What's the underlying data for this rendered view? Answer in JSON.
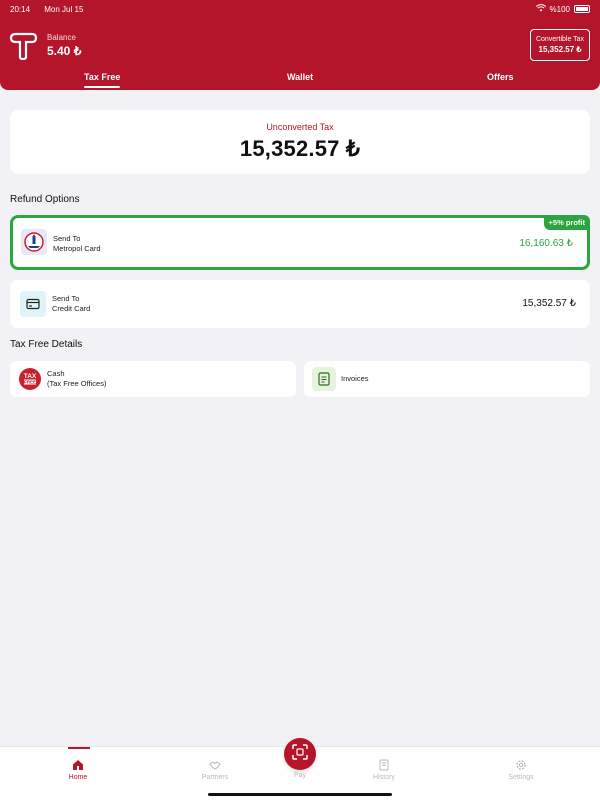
{
  "status_bar": {
    "time": "20:14",
    "date": "Mon Jul 15",
    "battery": "%100"
  },
  "header": {
    "balance_label": "Balance",
    "balance_value": "5.40 ₺",
    "convertible_label": "Convertible Tax",
    "convertible_value": "15,352.57 ₺",
    "tabs": [
      "Tax Free",
      "Wallet",
      "Offers"
    ],
    "active_tab": "Tax Free",
    "brand_color": "#b5152b"
  },
  "unconverted": {
    "label": "Unconverted Tax",
    "value": "15,352.57 ₺"
  },
  "refund": {
    "title": "Refund Options",
    "options": [
      {
        "line1": "Send To",
        "line2": "Metropol Card",
        "amount": "16,160.63 ₺",
        "badge": "+5% profit",
        "icon": "metropol-logo-icon",
        "accent": "#2aa53f"
      },
      {
        "line1": "Send To",
        "line2": "Credit Card",
        "amount": "15,352.57 ₺",
        "icon": "credit-card-icon"
      }
    ]
  },
  "details": {
    "title": "Tax Free Details",
    "items": [
      {
        "line1": "Cash",
        "line2": "(Tax Free Offices)",
        "icon": "tax-free-logo-icon",
        "logo_text": [
          "TAX",
          "FREE"
        ]
      },
      {
        "line1": "Invoices",
        "icon": "invoice-icon"
      }
    ]
  },
  "bottom_nav": {
    "items": [
      "Home",
      "Partners",
      "Pay",
      "History",
      "Settings"
    ],
    "active": "Home"
  }
}
